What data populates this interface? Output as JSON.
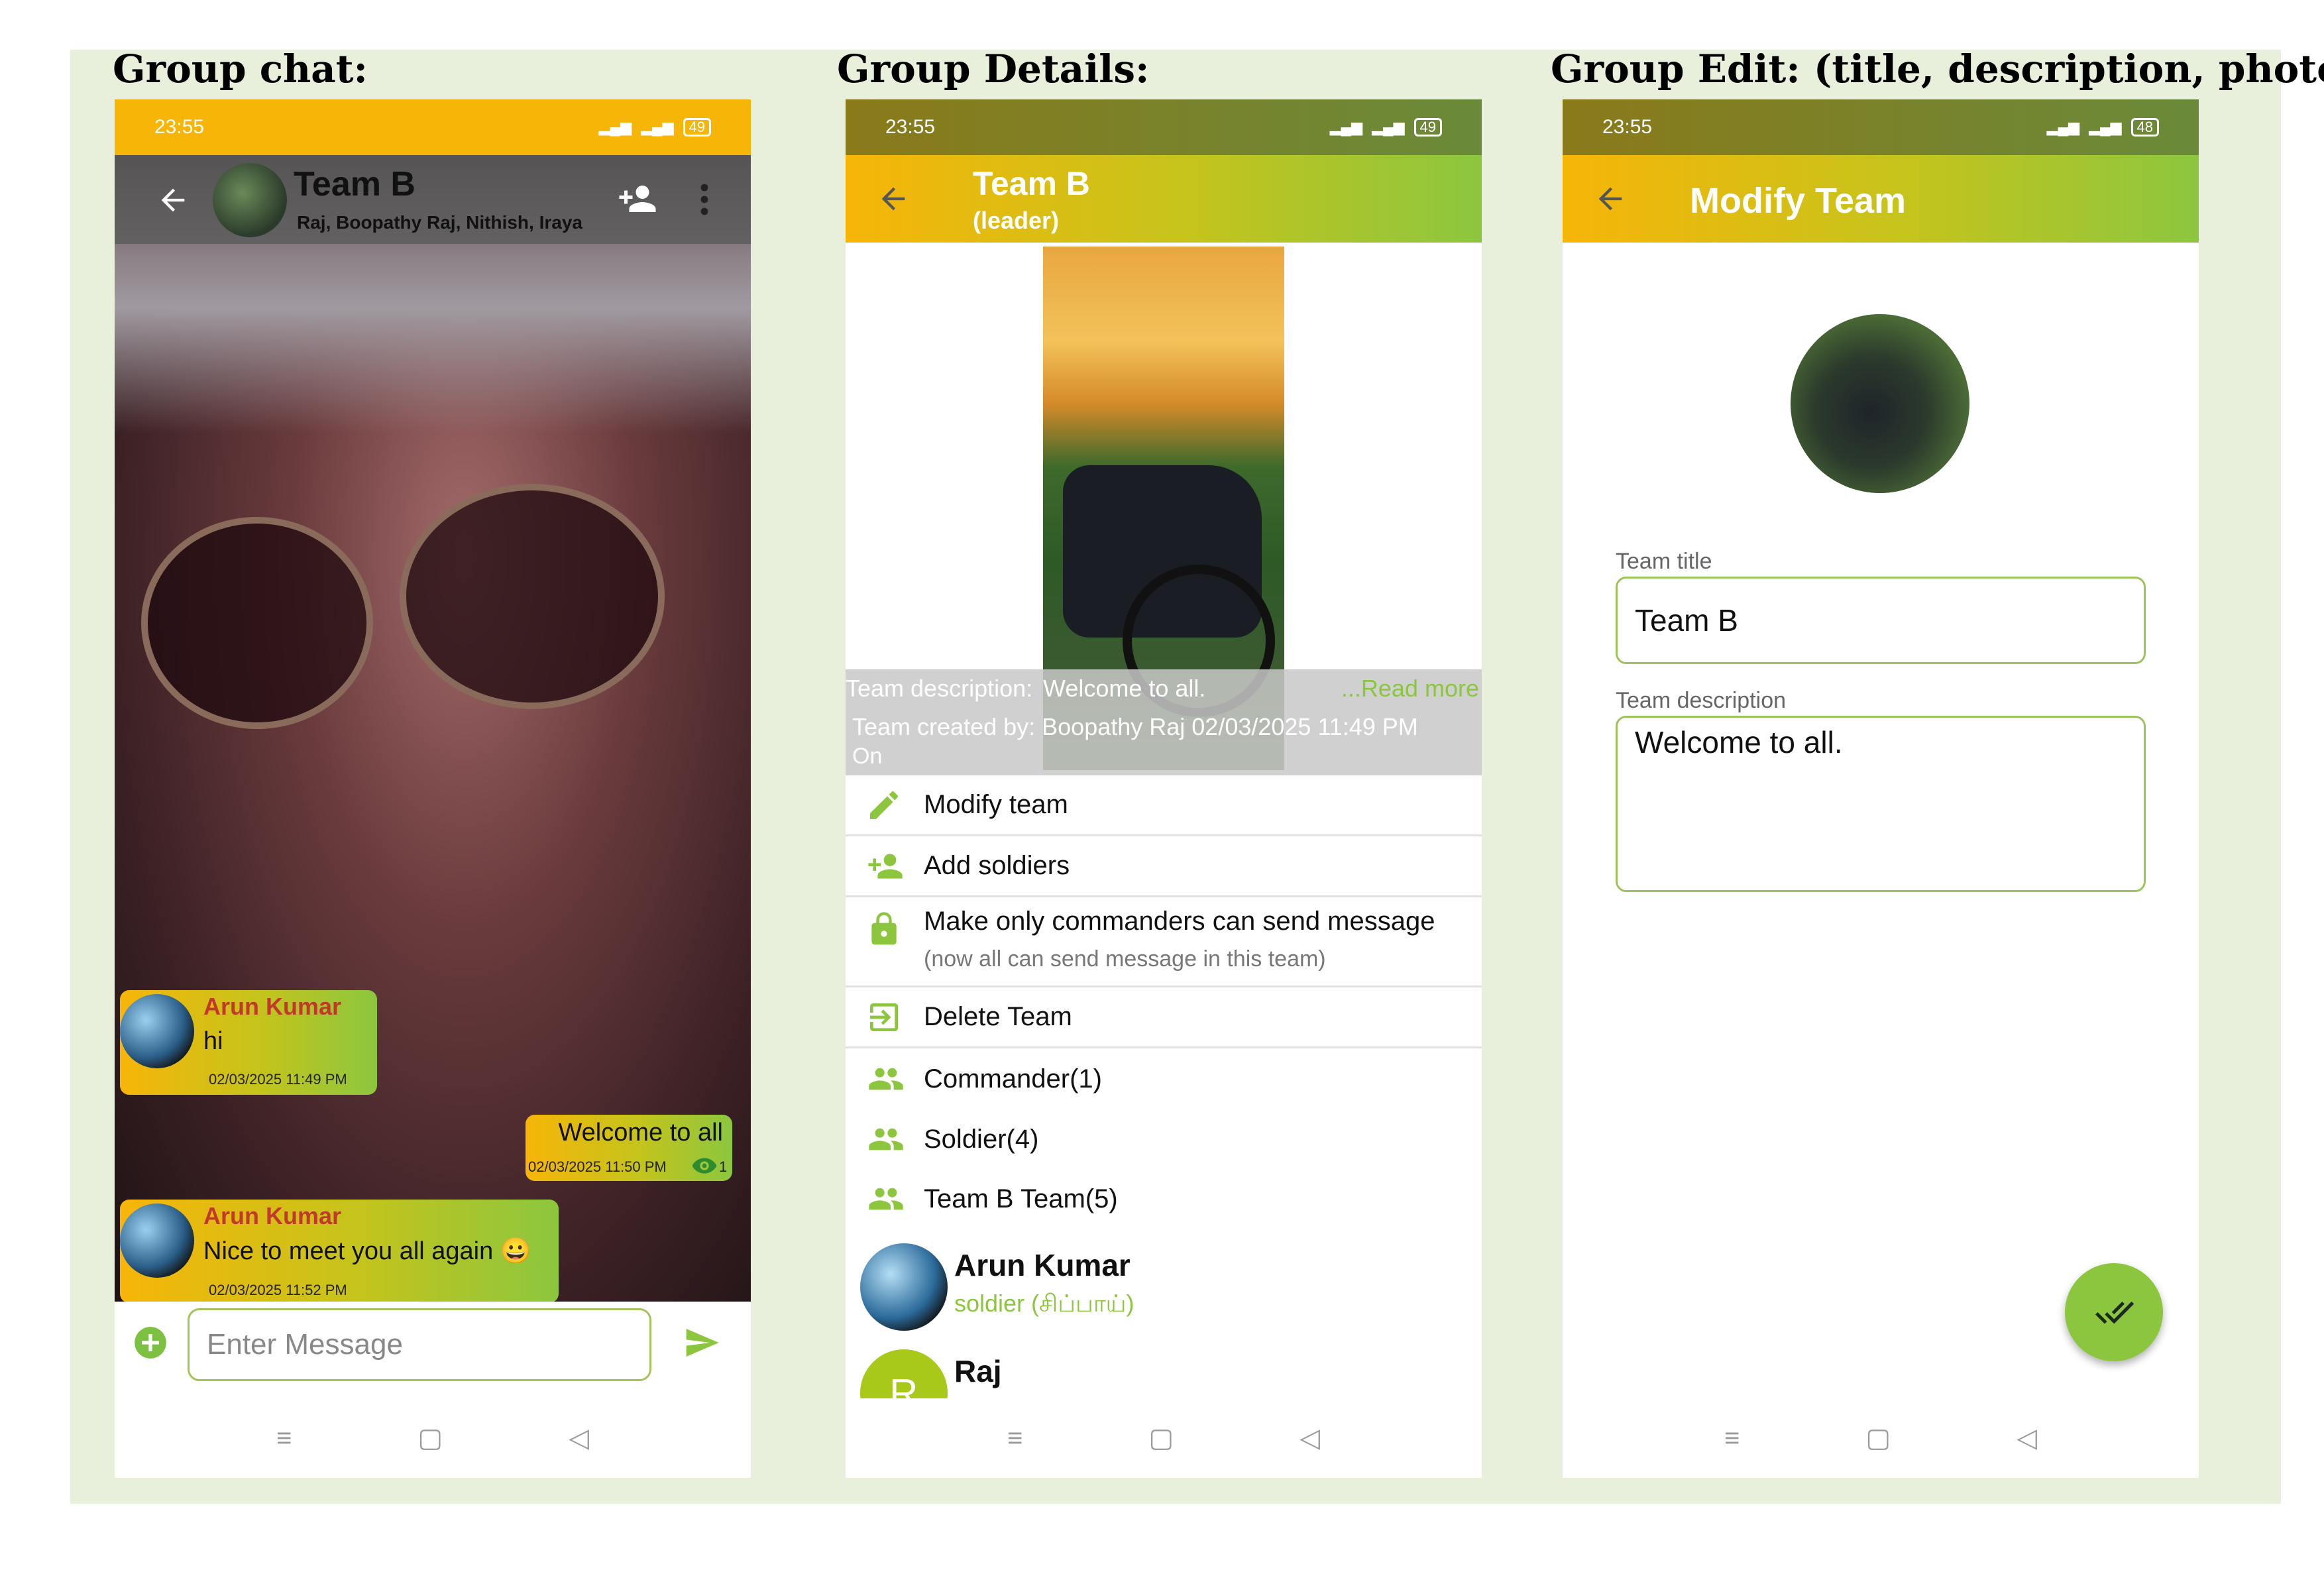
{
  "panels": {
    "chat_title": "Group chat:",
    "details_title": "Group Details:",
    "edit_title": "Group Edit: (title, description, photo"
  },
  "status": {
    "time": "23:55",
    "battery_chat": "49",
    "battery_details": "49",
    "battery_edit": "48",
    "network": "4G"
  },
  "colors": {
    "gradient_start": "#f7b508",
    "gradient_end": "#8cc63f",
    "accent_green": "#8cc63f",
    "sender_name_red": "#c0392b"
  },
  "chat": {
    "group_name": "Team B",
    "members": "Raj, Boopathy Raj, Nithish, Iraya",
    "messages": [
      {
        "sender": "Arun Kumar",
        "text": "hi",
        "time": "02/03/2025 11:49 PM"
      },
      {
        "text": "Welcome to all",
        "time": "02/03/2025 11:50 PM",
        "seen_count": "1"
      },
      {
        "sender": "Arun Kumar",
        "text": "Nice to meet you all again 😀",
        "time": "02/03/2025 11:52 PM"
      }
    ],
    "input_placeholder": "Enter Message"
  },
  "details": {
    "title": "Team B",
    "subtitle": "(leader)",
    "description_label": "Team description:",
    "description_value": "Welcome to all.",
    "read_more": "...Read more",
    "created_line": "Team created by: Boopathy Raj 02/03/2025 11:49 PM",
    "created_on": "On",
    "menu": [
      {
        "label": "Modify team",
        "icon": "pencil-icon"
      },
      {
        "label": "Add soldiers",
        "icon": "add-person-icon"
      },
      {
        "label": "Make only commanders can send message",
        "sub": "(now all can send message in this team)",
        "icon": "lock-icon"
      },
      {
        "label": "Delete Team",
        "icon": "exit-icon"
      },
      {
        "label": "Commander(1)",
        "icon": "group-icon"
      },
      {
        "label": "Soldier(4)",
        "icon": "group-icon"
      },
      {
        "label": "Team B Team(5)",
        "icon": "group-icon"
      }
    ],
    "members": [
      {
        "name": "Arun Kumar",
        "role": "soldier (சிப்பாய்)"
      },
      {
        "name": "Raj",
        "initial": "R"
      }
    ]
  },
  "edit": {
    "title": "Modify Team",
    "team_title_label": "Team title",
    "team_title_value": "Team B",
    "team_description_label": "Team description",
    "team_description_value": "Welcome to all."
  }
}
